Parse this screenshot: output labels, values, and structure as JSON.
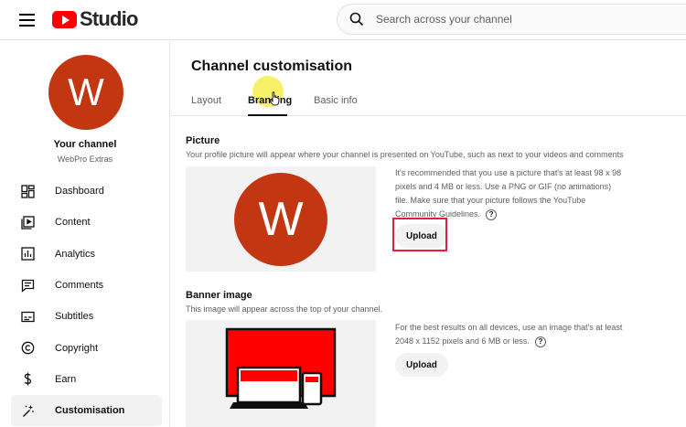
{
  "app": {
    "title": "Studio"
  },
  "search": {
    "placeholder": "Search across your channel"
  },
  "sidebar": {
    "avatar_letter": "W",
    "your_channel": "Your channel",
    "channel_name": "WebPro Extras",
    "items": [
      {
        "label": "Dashboard",
        "icon": "dashboard-icon"
      },
      {
        "label": "Content",
        "icon": "content-icon"
      },
      {
        "label": "Analytics",
        "icon": "analytics-icon"
      },
      {
        "label": "Comments",
        "icon": "comments-icon"
      },
      {
        "label": "Subtitles",
        "icon": "subtitles-icon"
      },
      {
        "label": "Copyright",
        "icon": "copyright-icon"
      },
      {
        "label": "Earn",
        "icon": "earn-icon"
      },
      {
        "label": "Customisation",
        "icon": "customisation-icon",
        "active": true
      }
    ]
  },
  "main": {
    "title": "Channel customisation",
    "tabs": [
      {
        "label": "Layout"
      },
      {
        "label": "Branding",
        "active": true
      },
      {
        "label": "Basic info"
      }
    ],
    "picture": {
      "title": "Picture",
      "description": "Your profile picture will appear where your channel is presented on YouTube, such as next to your videos and comments",
      "avatar_letter": "W",
      "info": "It's recommended that you use a picture that's at least 98 x 98 pixels and 4 MB or less. Use a PNG or GIF (no animations) file. Make sure that your picture follows the YouTube Community Guidelines.",
      "help": "?",
      "upload_label": "Upload"
    },
    "banner": {
      "title": "Banner image",
      "description": "This image will appear across the top of your channel.",
      "info": "For the best results on all devices, use an image that's at least 2048 x 1152 pixels and 6 MB or less.",
      "help": "?",
      "upload_label": "Upload"
    }
  },
  "colors": {
    "brand_red": "#ff0000",
    "avatar": "#c33612",
    "highlight_box": "#e0203a",
    "cursor_halo": "#f5eb37"
  }
}
